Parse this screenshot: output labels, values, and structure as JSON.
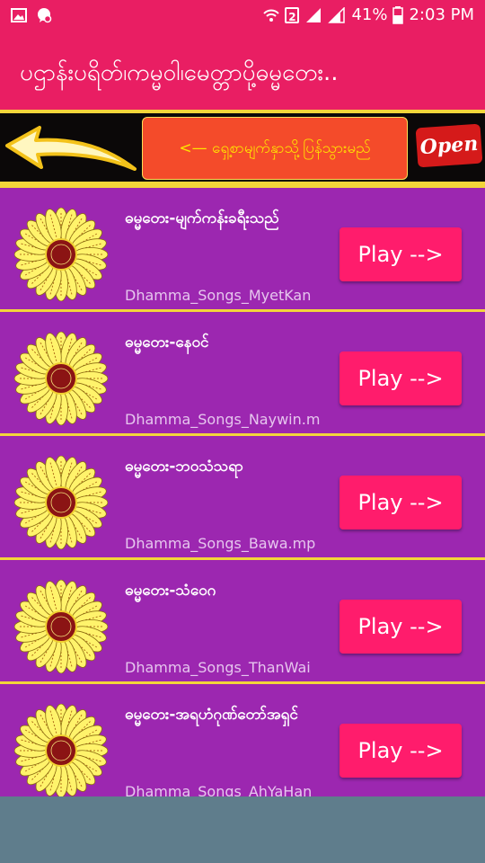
{
  "status_bar": {
    "battery": "41%",
    "time": "2:03 PM",
    "sim_slot": "2",
    "icons": [
      "image-icon",
      "messenger-icon",
      "wifi-icon",
      "signal-icon",
      "battery-icon"
    ]
  },
  "app_bar": {
    "title": "ပဌာန်းပရိတ်၊ကမ္မဝါ၊မေတ္တာပို့ဓမ္မတေး.."
  },
  "banner": {
    "back_button_label": "<— ရှေ့စာမျက်နှာသို့ပြန်သွားမည်",
    "open_label": "Open",
    "icon": "back-arrow-icon"
  },
  "songs": [
    {
      "title": "ဓမ္မတေး-မျက်ကန်းခရီးသည်",
      "file": "Dhamma_Songs_MyetKan",
      "play_label": "Play -->"
    },
    {
      "title": "ဓမ္မတေး-နေဝင်",
      "file": "Dhamma_Songs_Naywin.m",
      "play_label": "Play -->"
    },
    {
      "title": "ဓမ္မတေး-ဘဝသံသရာ",
      "file": "Dhamma_Songs_Bawa.mp",
      "play_label": "Play -->"
    },
    {
      "title": "ဓမ္မတေး-သံဝေဂ",
      "file": "Dhamma_Songs_ThanWai",
      "play_label": "Play -->"
    },
    {
      "title": "ဓမ္မတေး-အရဟံဂုဏ်တော်အရှင်",
      "file": "Dhamma_Songs_AhYaHan",
      "play_label": "Play -->"
    }
  ],
  "colors": {
    "primary": "#e91e63",
    "row_background": "#9c27b0",
    "play_button": "#ff1c6c",
    "divider": "#f3d53a",
    "banner_button": "#f44b2a",
    "banner_text": "#ffe600",
    "bottom_area": "#5f7d8c"
  }
}
